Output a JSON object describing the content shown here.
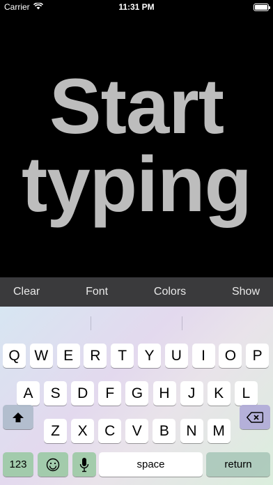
{
  "status": {
    "carrier": "Carrier",
    "time": "11:31 PM",
    "battery_level": 1.0
  },
  "canvas": {
    "placeholder": "Start typing"
  },
  "toolbar": {
    "clear": "Clear",
    "font": "Font",
    "colors": "Colors",
    "show": "Show"
  },
  "keyboard": {
    "row1": [
      "Q",
      "W",
      "E",
      "R",
      "T",
      "Y",
      "U",
      "I",
      "O",
      "P"
    ],
    "row2": [
      "A",
      "S",
      "D",
      "F",
      "G",
      "H",
      "J",
      "K",
      "L"
    ],
    "row3": [
      "Z",
      "X",
      "C",
      "V",
      "B",
      "N",
      "M"
    ],
    "numbers_label": "123",
    "space_label": "space",
    "return_label": "return"
  }
}
